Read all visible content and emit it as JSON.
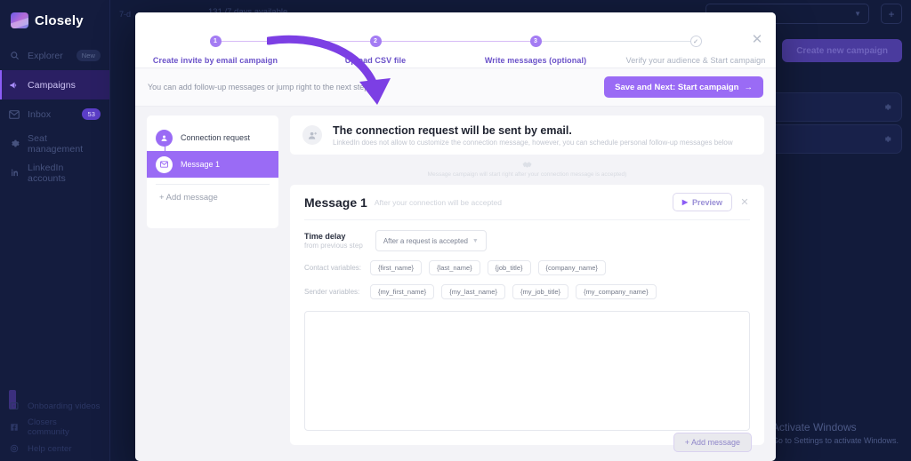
{
  "sidebar": {
    "brand": "Closely",
    "items": [
      {
        "label": "Explorer",
        "icon": "search-icon",
        "badge": "New",
        "active": false
      },
      {
        "label": "Campaigns",
        "icon": "megaphone-icon",
        "badge": "",
        "active": true
      },
      {
        "label": "Inbox",
        "icon": "envelope-icon",
        "badge": "53",
        "active": false
      },
      {
        "label": "Seat management",
        "icon": "gear-icon",
        "badge": "",
        "active": false
      },
      {
        "label": "LinkedIn accounts",
        "icon": "linkedin-icon",
        "badge": "",
        "active": false
      }
    ],
    "bottom_items": [
      {
        "label": "Onboarding videos",
        "icon": "video-icon"
      },
      {
        "label": "Closers community",
        "icon": "facebook-icon"
      },
      {
        "label": "Help center",
        "icon": "lifebuoy-icon"
      }
    ]
  },
  "topbar": {
    "credits_left": "7-d",
    "credits_center": "131 /7 days available",
    "account_select_chevron": "chevron-down-icon",
    "add_button": "+",
    "create_campaign_label": "Create new campaign"
  },
  "watermark": {
    "title": "Activate Windows",
    "subtitle": "Go to Settings to activate Windows."
  },
  "modal": {
    "close_icon": "close-icon",
    "stepper": [
      {
        "num": "1",
        "label": "Create invite by email campaign",
        "state": "active"
      },
      {
        "num": "2",
        "label": "Upload CSV file",
        "state": "active"
      },
      {
        "num": "3",
        "label": "Write messages (optional)",
        "state": "active"
      },
      {
        "num": "✓",
        "label": "Verify your audience & Start campaign",
        "state": "done"
      }
    ],
    "subbar": {
      "hint": "You can add follow-up messages or jump right to the next step.",
      "save_label": "Save and Next: Start campaign",
      "save_arrow": "arrow-right-icon"
    },
    "steplist": {
      "items": [
        {
          "label": "Connection request",
          "icon": "person-icon",
          "selected": false
        },
        {
          "label": "Message 1",
          "icon": "envelope-icon",
          "selected": true
        }
      ],
      "add_label": "+ Add message"
    },
    "info_card": {
      "icon": "person-add-icon",
      "title": "The connection request will be sent by email.",
      "subtitle": "LinkedIn does not allow to customize the connection message, however, you can schedule personal follow-up messages below"
    },
    "mid_note": {
      "icon": "handshake-icon",
      "text": "Message campaign will start right after your connection message is accepted)"
    },
    "message_card": {
      "title": "Message 1",
      "subtitle": "After your connection will be accepted",
      "preview_label": "Preview",
      "preview_icon": "play-icon",
      "close_icon": "close-icon",
      "delay_label_1": "Time delay",
      "delay_label_2": "from previous step",
      "delay_value": "After a request is accepted",
      "delay_chevron": "chevron-down-icon",
      "contact_variables_label": "Contact variables:",
      "contact_variables": [
        "{first_name}",
        "{last_name}",
        "{job_title}",
        "{company_name}"
      ],
      "sender_variables_label": "Sender variables:",
      "sender_variables": [
        "{my_first_name}",
        "{my_last_name}",
        "{my_job_title}",
        "{my_company_name}"
      ],
      "body_text": ""
    },
    "add_message_label": "+ Add message"
  },
  "colors": {
    "accent": "#9a6bf5",
    "accent_dark": "#6b52c9",
    "app_bg": "#121b3b",
    "sidebar_bg": "#141c3e"
  }
}
